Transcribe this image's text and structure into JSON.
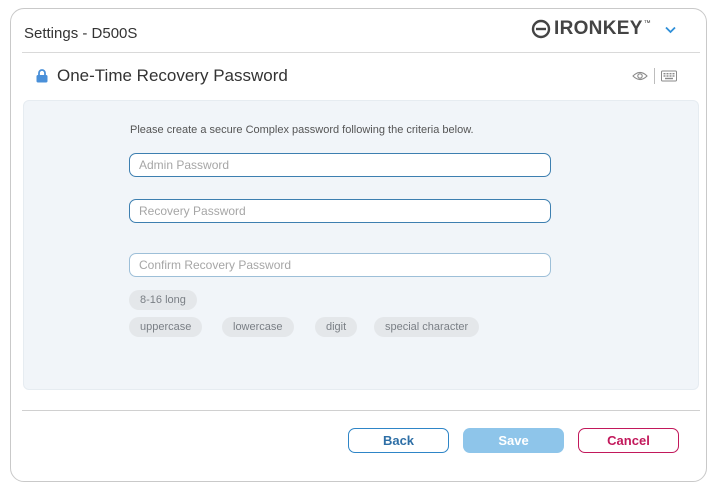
{
  "header": {
    "title": "Settings - D500S",
    "logo_text": "IRONKEY",
    "logo_tm": "™",
    "menu_icon": "chevron-down-icon"
  },
  "section": {
    "title": "One-Time Recovery Password",
    "icon": "lock-icon",
    "tools": [
      "eye-icon",
      "keyboard-icon"
    ]
  },
  "form": {
    "instruction": "Please create a secure Complex password following the criteria below.",
    "admin_password": {
      "placeholder": "Admin Password",
      "value": ""
    },
    "recovery_password": {
      "placeholder": "Recovery Password",
      "value": ""
    },
    "confirm_password": {
      "placeholder": "Confirm Recovery Password",
      "value": ""
    }
  },
  "criteria": {
    "length": "8-16 long",
    "items": [
      "uppercase",
      "lowercase",
      "digit",
      "special character"
    ]
  },
  "buttons": {
    "back": "Back",
    "save": "Save",
    "cancel": "Cancel"
  },
  "colors": {
    "accent": "#2e85c7",
    "save_disabled": "#8ec5ea",
    "cancel": "#c2185b",
    "lock": "#4a90d9"
  }
}
